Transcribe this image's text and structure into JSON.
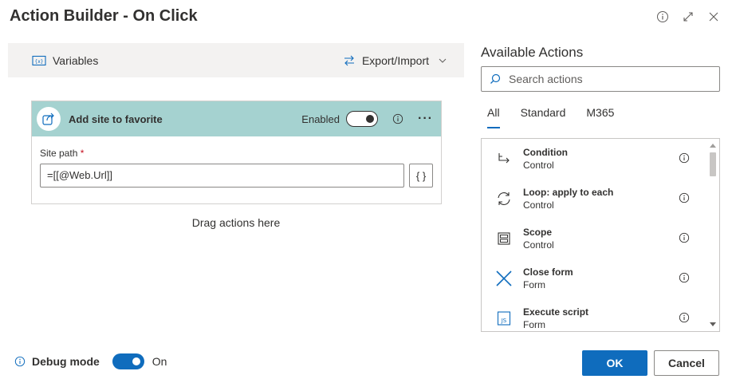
{
  "dialog": {
    "title": "Action Builder - On Click",
    "icons": [
      "info-icon",
      "expand-icon",
      "close-icon"
    ]
  },
  "toolbar": {
    "variables_label": "Variables",
    "export_import_label": "Export/Import"
  },
  "action_card": {
    "title": "Add site to favorite",
    "enabled_label": "Enabled",
    "enabled": true,
    "more_label": "···",
    "field_label": "Site path",
    "required_mark": "*",
    "field_value": "=[[@Web.Url]]",
    "fx_label": "{ }"
  },
  "canvas": {
    "drag_hint": "Drag actions here"
  },
  "panel": {
    "title": "Available Actions",
    "search_placeholder": "Search actions",
    "tabs": [
      {
        "label": "All",
        "active": true
      },
      {
        "label": "Standard",
        "active": false
      },
      {
        "label": "M365",
        "active": false
      }
    ],
    "actions": [
      {
        "name": "Condition",
        "category": "Control",
        "icon": "condition-icon"
      },
      {
        "name": "Loop: apply to each",
        "category": "Control",
        "icon": "loop-icon"
      },
      {
        "name": "Scope",
        "category": "Control",
        "icon": "scope-icon"
      },
      {
        "name": "Close form",
        "category": "Form",
        "icon": "close-form-icon"
      },
      {
        "name": "Execute script",
        "category": "Form",
        "icon": "script-icon"
      }
    ]
  },
  "footer": {
    "debug_label": "Debug mode",
    "debug_state": "On",
    "ok_label": "OK",
    "cancel_label": "Cancel"
  },
  "colors": {
    "accent": "#0f6cbd",
    "card_header": "#a5d2d0",
    "toolbar_bg": "#f3f2f1"
  }
}
